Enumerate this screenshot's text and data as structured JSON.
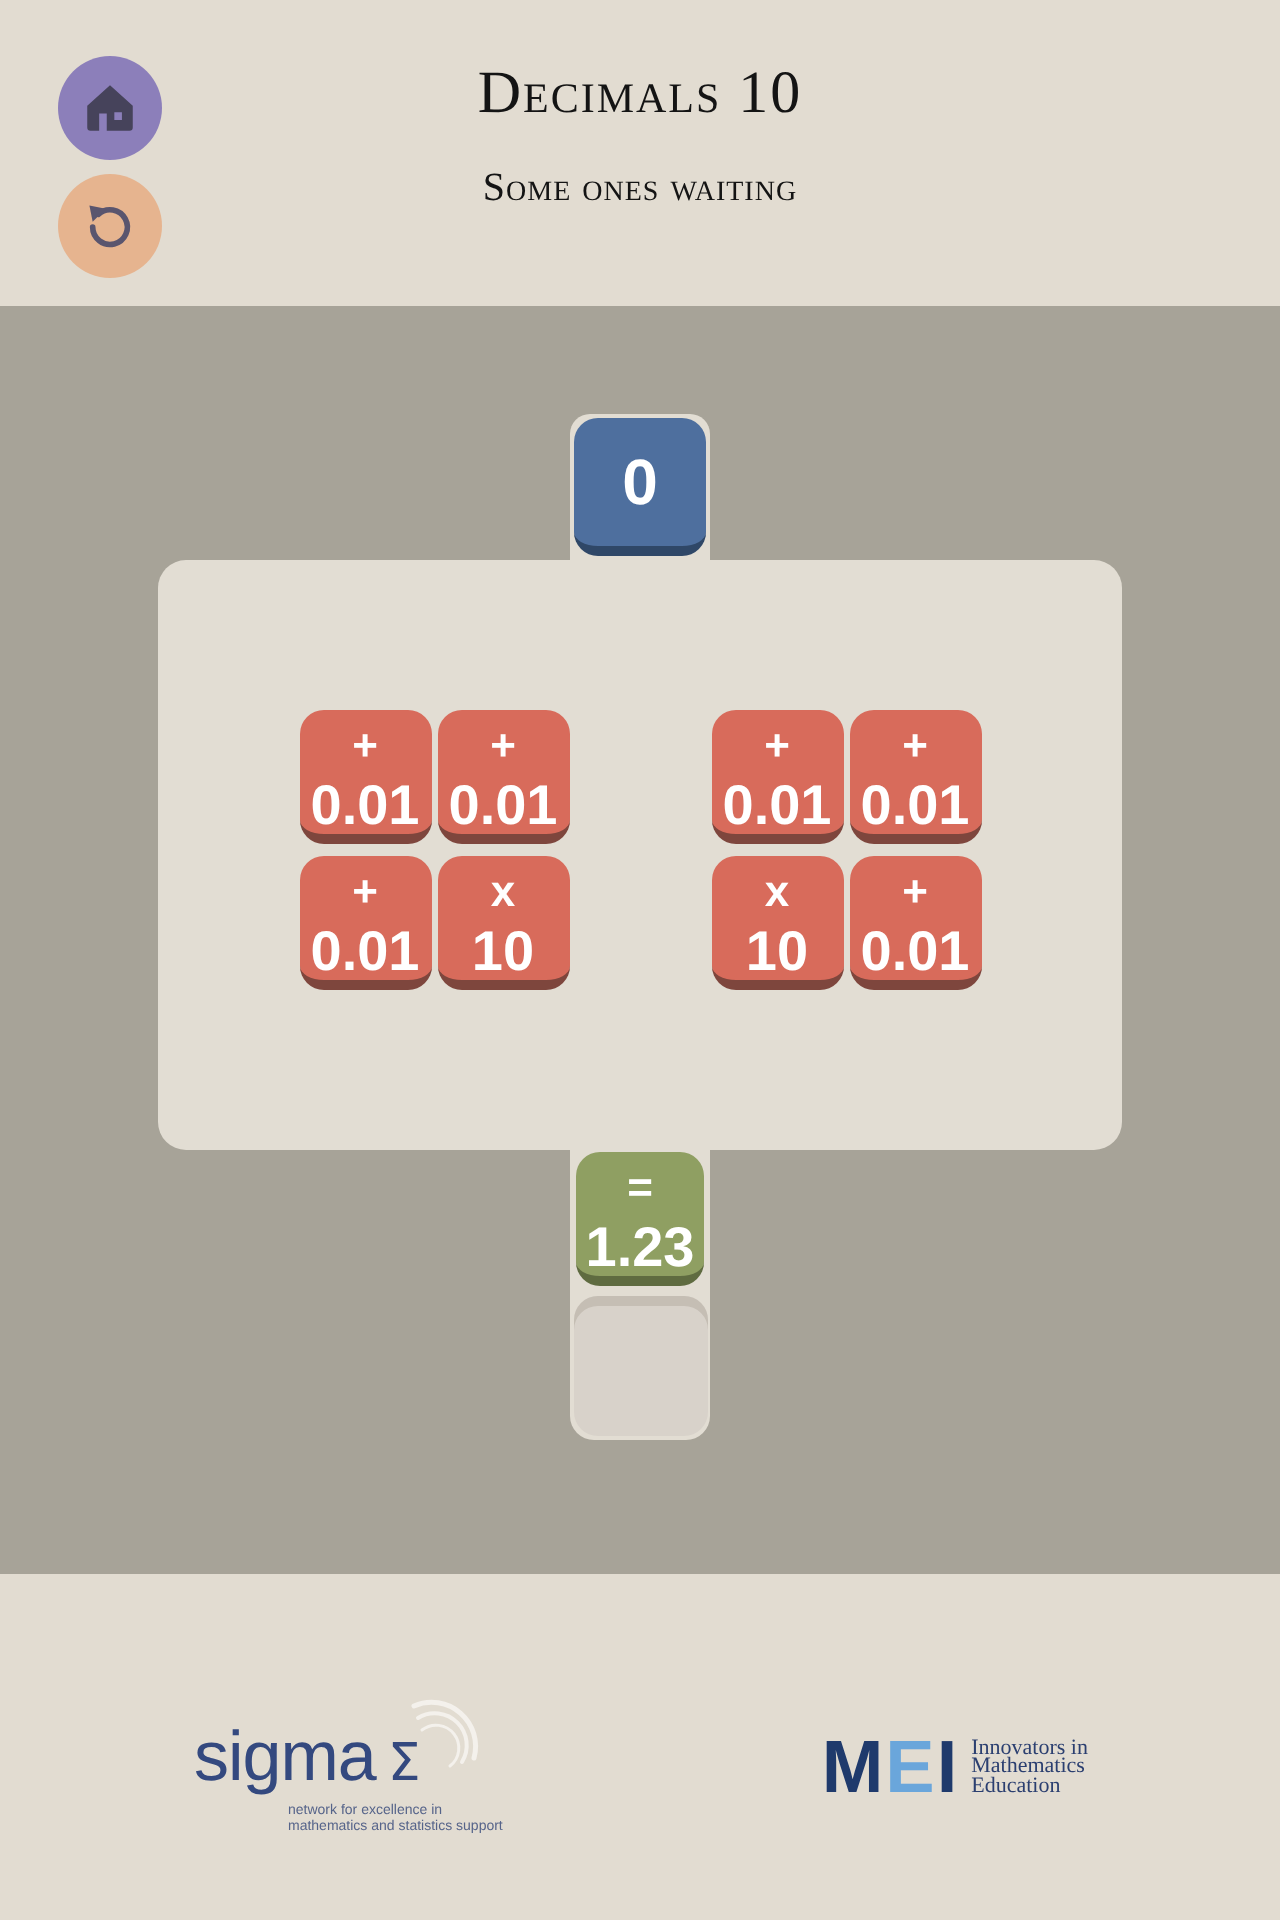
{
  "header": {
    "title": "Decimals 10",
    "subtitle": "Some ones waiting"
  },
  "board": {
    "start_tile": {
      "value": "0"
    },
    "tile_groups": [
      {
        "tiles": [
          {
            "op": "+",
            "value": "0.01"
          },
          {
            "op": "+",
            "value": "0.01"
          },
          {
            "op": "+",
            "value": "0.01"
          },
          {
            "op": "x",
            "value": "10"
          }
        ]
      },
      {
        "tiles": [
          {
            "op": "+",
            "value": "0.01"
          },
          {
            "op": "+",
            "value": "0.01"
          },
          {
            "op": "x",
            "value": "10"
          },
          {
            "op": "+",
            "value": "0.01"
          }
        ]
      }
    ],
    "target_tile": {
      "op": "=",
      "value": "1.23"
    }
  },
  "footer": {
    "logos": [
      {
        "kind": "sigma",
        "wordmark": "sigma",
        "symbol": "Σ",
        "tagline": [
          "network for excellence in",
          "mathematics and statistics support"
        ]
      },
      {
        "kind": "mei",
        "wordmark": "MEI",
        "tagline": [
          "Innovators in",
          "Mathematics",
          "Education"
        ]
      }
    ]
  }
}
